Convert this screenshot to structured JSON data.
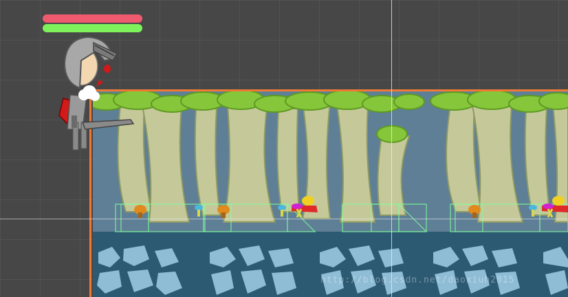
{
  "game": {
    "player": {
      "health_fraction": 1.0,
      "energy_fraction": 1.0,
      "health_color": "#f05a6e",
      "energy_color": "#7df25a"
    },
    "colors": {
      "editor_bg": "#474747",
      "level_border": "#f07a35",
      "collider_outline": "#7dff9a",
      "forest_bg": "#5e7f96",
      "ground_bg": "#2d5a73",
      "stone": "#8fbdd6"
    },
    "watermark": "http://blog.csdn.net/daoxiuh2015"
  }
}
